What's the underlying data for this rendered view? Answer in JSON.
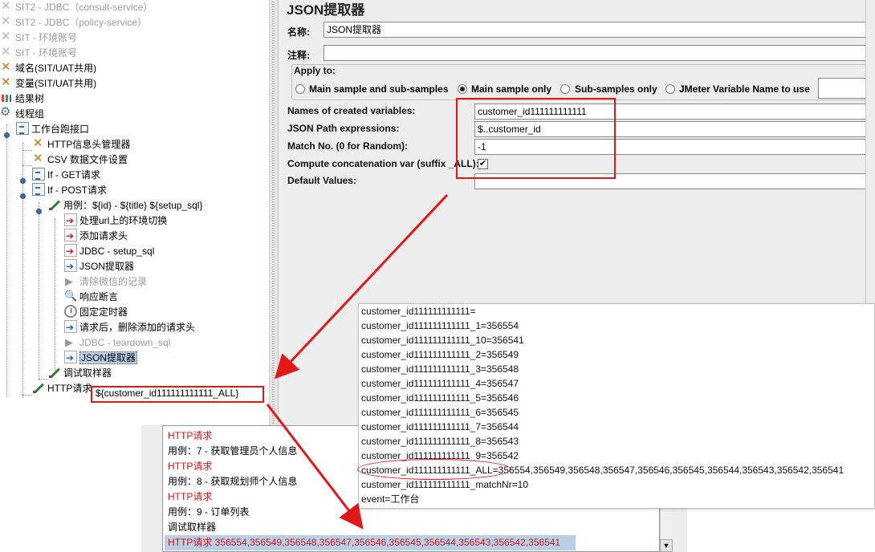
{
  "tree": {
    "items": [
      {
        "label": "SIT2 - JDBC（consult-service）",
        "icon": "wrench-icon",
        "disabled": true
      },
      {
        "label": "SIT2 - JDBC（policy-service）",
        "icon": "wrench-icon",
        "disabled": true
      },
      {
        "label": "SIT - 环境账号",
        "icon": "wrench-icon",
        "disabled": true
      },
      {
        "label": "SIT - 环境账号",
        "icon": "wrench-icon",
        "disabled": true
      },
      {
        "label": "域名(SIT/UAT共用)",
        "icon": "tool-icon",
        "disabled": false
      },
      {
        "label": "变量(SIT/UAT共用)",
        "icon": "tool-icon",
        "disabled": false
      },
      {
        "label": "结果树",
        "icon": "chart-icon",
        "disabled": false
      },
      {
        "label": "线程组",
        "icon": "gear-icon",
        "disabled": false
      },
      {
        "label": "工作台跑接口",
        "icon": "doc-icon",
        "disabled": false
      },
      {
        "label": "HTTP信息头管理器",
        "icon": "tool-icon",
        "disabled": false
      },
      {
        "label": "CSV 数据文件设置",
        "icon": "tool-icon",
        "disabled": false
      },
      {
        "label": "If - GET请求",
        "icon": "doc-icon",
        "disabled": false
      },
      {
        "label": "If - POST请求",
        "icon": "doc-icon",
        "disabled": false
      },
      {
        "label": "用例：${id} - ${title}  ${setup_sql}",
        "icon": "pen-icon",
        "disabled": false
      },
      {
        "label": "处理url上的环境切换",
        "icon": "arrow-red-icon",
        "disabled": false
      },
      {
        "label": "添加请求头",
        "icon": "arrow-red-icon",
        "disabled": false
      },
      {
        "label": "JDBC - setup_sql",
        "icon": "arrow-red-icon",
        "disabled": false
      },
      {
        "label": "JSON提取器",
        "icon": "arrow-blue-icon",
        "disabled": false
      },
      {
        "label": "清除微信的记录",
        "icon": "flag-icon",
        "disabled": true
      },
      {
        "label": "响应断言",
        "icon": "magnify-icon",
        "disabled": false
      },
      {
        "label": "固定定时器",
        "icon": "clock-icon",
        "disabled": false
      },
      {
        "label": "请求后，删除添加的请求头",
        "icon": "arrow-blue-icon",
        "disabled": false
      },
      {
        "label": "JDBC - teardown_sql",
        "icon": "flag-icon",
        "disabled": true
      },
      {
        "label": "JSON提取器",
        "icon": "arrow-blue-icon",
        "disabled": false,
        "selected": true
      },
      {
        "label": "调试取样器",
        "icon": "pen-icon",
        "disabled": false
      },
      {
        "label": "HTTP请求",
        "icon": "pen-icon",
        "disabled": false
      }
    ],
    "http_request_annotation": "${customer_id111111111111_ALL}"
  },
  "config": {
    "title": "JSON提取器",
    "name_label": "名称:",
    "name_value": "JSON提取器",
    "comment_label": "注释:",
    "comment_value": "",
    "apply_to_label": "Apply to:",
    "apply_options": [
      {
        "label": "Main sample and sub-samples",
        "checked": false
      },
      {
        "label": "Main sample only",
        "checked": true
      },
      {
        "label": "Sub-samples only",
        "checked": false
      },
      {
        "label": "JMeter Variable Name to use",
        "checked": false
      }
    ],
    "fields": {
      "names_label": "Names of created variables:",
      "names_value": "customer_id111111111111",
      "json_path_label": "JSON Path expressions:",
      "json_path_value": "$..customer_id",
      "match_no_label": "Match No. (0 for Random):",
      "match_no_value": "-1",
      "concat_label": "Compute concatenation var (suffix _ALL):",
      "concat_checked": true,
      "concat_check_glyph": "✔",
      "default_label": "Default Values:",
      "default_value": ""
    }
  },
  "results": {
    "rows": [
      {
        "text": "HTTP请求",
        "red": true
      },
      {
        "text": "用例：7 - 获取管理员个人信息",
        "red": false
      },
      {
        "text": "HTTP请求",
        "red": true
      },
      {
        "text": "用例：8 - 获取规划师个人信息",
        "red": false
      },
      {
        "text": "HTTP请求",
        "red": true
      },
      {
        "text": "用例：9 - 订单列表",
        "red": false
      },
      {
        "text": "调试取样器",
        "red": false
      },
      {
        "text": "HTTP请求 356554,356549,356548,356547,356546,356545,356544,356543,356542,356541",
        "red": true,
        "selected": true
      }
    ]
  },
  "debug": {
    "lines": [
      "customer_id111111111111=",
      "customer_id111111111111_1=356554",
      "customer_id111111111111_10=356541",
      "customer_id111111111111_2=356549",
      "customer_id111111111111_3=356548",
      "customer_id111111111111_4=356547",
      "customer_id111111111111_5=356546",
      "customer_id111111111111_6=356545",
      "customer_id111111111111_7=356544",
      "customer_id111111111111_8=356543",
      "customer_id111111111111_9=356542",
      "customer_id111111111111_ALL=356554,356549,356548,356547,356546,356545,356544,356543,356542,356541",
      "customer_id111111111111_matchNr=10",
      "event=工作台"
    ]
  },
  "colors": {
    "annotation_red": "#e01818",
    "selection_blue": "#b8cfe5",
    "panel_gray": "#ededed"
  }
}
